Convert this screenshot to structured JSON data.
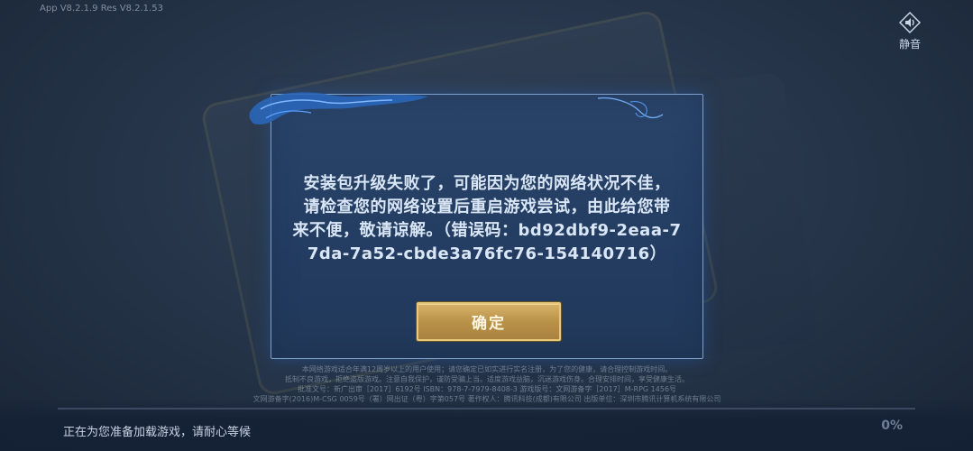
{
  "top": {
    "version_text": "App V8.2.1.9   Res V8.2.1.53",
    "mute_label": "静音",
    "mute_icon": "speaker-icon"
  },
  "dialog": {
    "message_lines": [
      "安装包升级失败了，可能因为您的网络状况不佳，",
      "请检查您的网络设置后重启游戏尝试，由此给您带",
      "来不便，敬请谅解。（错误码：bd92dbf9-2eaa-7",
      "7da-7a52-cbde3a76fc76-154140716）"
    ],
    "confirm_label": "确定",
    "colors": {
      "panel": "#243d62",
      "border": "#7fa0c8",
      "button": "#b9924a",
      "text": "#d9e6f6"
    }
  },
  "footer": {
    "legal_lines": [
      "本网络游戏适合年满12周岁以上的用户使用；请您确定已如实进行实名注册，为了您的健康，请合理控制游戏时间。",
      "抵制不良游戏，拒绝盗版游戏。注意自我保护，谨防受骗上当。适度游戏益脑，沉迷游戏伤身。合理安排时间，享受健康生活。",
      "批准文号：新广出审［2017］6192号  ISBN：978-7-7979-8408-3  游戏版号：文网游备字［2017］M-RPG 1456号",
      "文网游备字(2016)M-CSG 0059号（署）网出证（粤）字第057号  著作权人：腾讯科技(成都)有限公司  出版单位：深圳市腾讯计算机系统有限公司"
    ],
    "loading_text": "正在为您准备加载游戏，请耐心等候",
    "progress_percent": "0%",
    "progress_value": 0
  }
}
